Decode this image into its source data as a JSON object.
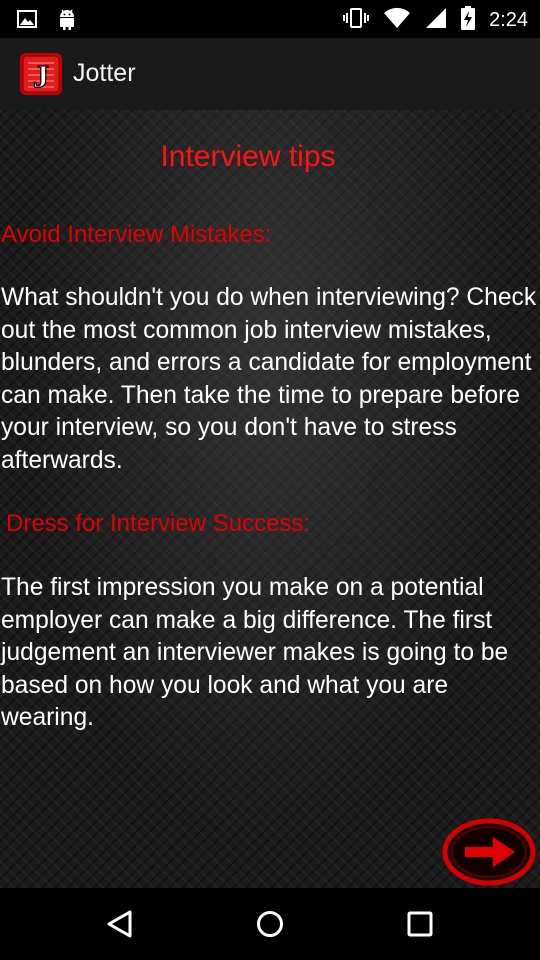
{
  "status_bar": {
    "time": "2:24",
    "left_icons": [
      "image-icon",
      "android-icon"
    ],
    "right_icons": [
      "vibrate-icon",
      "wifi-icon",
      "cell-signal-icon",
      "battery-charging-icon"
    ]
  },
  "action_bar": {
    "app_icon": "jotter-logo-icon",
    "app_icon_letter": "J",
    "title": "Jotter"
  },
  "content": {
    "title": "Interview tips",
    "sections": [
      {
        "heading": "Avoid Interview Mistakes:",
        "body": "What shouldn't you do when interviewing? Check out the most common job interview mistakes, blunders, and errors a candidate for employment can make. Then take the time to prepare before your interview, so you don't have to stress afterwards."
      },
      {
        "heading": "Dress for Interview Success:",
        "body": "The first impression you make on a potential employer can make a big difference. The first judgement an interviewer makes is going to be based on how you look and what you are wearing."
      }
    ],
    "next_button_icon": "arrow-right-icon"
  },
  "nav_bar": {
    "icons": [
      "back-icon",
      "home-icon",
      "recents-icon"
    ]
  },
  "colors": {
    "accent_red": "#e00000",
    "title_red": "#ff1414",
    "text": "#ffffff",
    "action_bar_bg": "#1a1a1a"
  }
}
